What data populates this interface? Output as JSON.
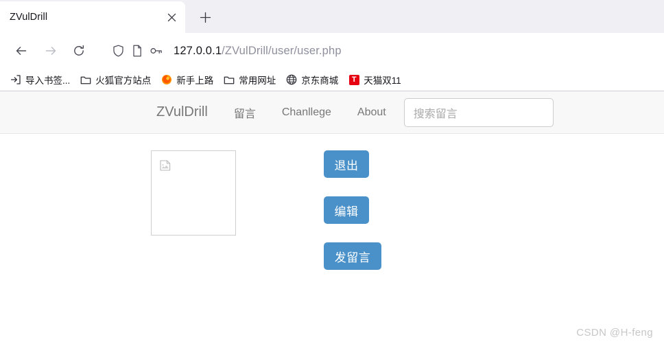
{
  "browser": {
    "tab": {
      "title": "ZVulDrill",
      "close_icon": "close-icon"
    },
    "new_tab_icon": "plus-icon",
    "toolbar": {
      "back_icon": "back-arrow-icon",
      "forward_icon": "forward-arrow-icon",
      "reload_icon": "reload-icon",
      "shield_icon": "shield-icon",
      "page_icon": "page-icon",
      "key_icon": "key-icon",
      "url_host": "127.0.0.1",
      "url_path": "/ZVulDrill/user/user.php"
    },
    "bookmarks": [
      {
        "label": "导入书签...",
        "icon": "import-bookmarks-icon"
      },
      {
        "label": "火狐官方站点",
        "icon": "folder-icon"
      },
      {
        "label": "新手上路",
        "icon": "firefox-icon"
      },
      {
        "label": "常用网址",
        "icon": "folder-icon"
      },
      {
        "label": "京东商城",
        "icon": "globe-icon"
      },
      {
        "label": "天猫双11",
        "icon": "tmall-icon",
        "icon_text": "T"
      }
    ]
  },
  "page": {
    "nav": {
      "brand": "ZVulDrill",
      "links": [
        {
          "label": "留言"
        },
        {
          "label": "Chanllege"
        },
        {
          "label": "About"
        }
      ],
      "search_placeholder": "搜索留言"
    },
    "avatar": {
      "alt_icon": "broken-image-icon"
    },
    "buttons": [
      {
        "label": "退出",
        "name": "logout-button"
      },
      {
        "label": "编辑",
        "name": "edit-button"
      },
      {
        "label": "发留言",
        "name": "post-message-button"
      }
    ],
    "watermark": "CSDN @H-feng",
    "colors": {
      "button_blue": "#4a91ca",
      "nav_text": "#777777",
      "navbar_bg": "#f8f8f8"
    }
  }
}
